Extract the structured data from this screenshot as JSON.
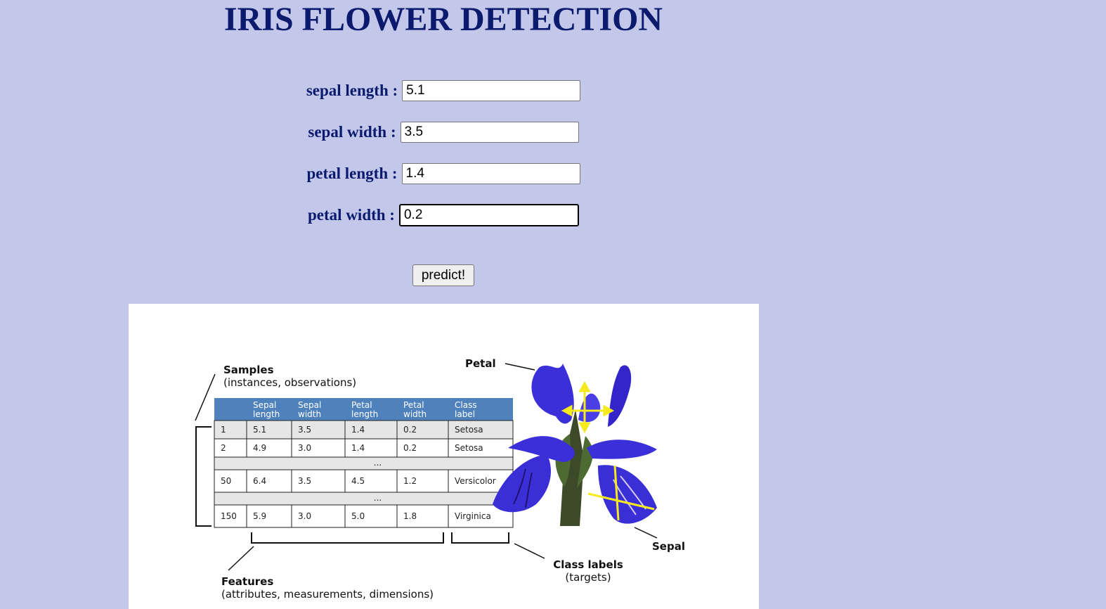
{
  "page": {
    "title": "IRIS FLOWER DETECTION"
  },
  "form": {
    "fields": [
      {
        "label": "sepal length :",
        "value": "5.1"
      },
      {
        "label": "sepal width :",
        "value": "3.5"
      },
      {
        "label": "petal length :",
        "value": "1.4"
      },
      {
        "label": "petal width :",
        "value": "0.2"
      }
    ],
    "submit_label": "predict!"
  },
  "figure": {
    "samples_title": "Samples",
    "samples_subtitle": "(instances, observations)",
    "petal_label": "Petal",
    "sepal_label": "Sepal",
    "class_labels_title": "Class labels",
    "class_labels_subtitle": "(targets)",
    "features_title": "Features",
    "features_subtitle": "(attributes, measurements, dimensions)",
    "table": {
      "headers": [
        [
          "",
          ""
        ],
        [
          "Sepal",
          "length"
        ],
        [
          "Sepal",
          "width"
        ],
        [
          "Petal",
          "length"
        ],
        [
          "Petal",
          "width"
        ],
        [
          "Class",
          "label"
        ]
      ],
      "rows": [
        [
          "1",
          "5.1",
          "3.5",
          "1.4",
          "0.2",
          "Setosa"
        ],
        [
          "2",
          "4.9",
          "3.0",
          "1.4",
          "0.2",
          "Setosa"
        ],
        [
          "...",
          "",
          "",
          "",
          "",
          ""
        ],
        [
          "50",
          "6.4",
          "3.5",
          "4.5",
          "1.2",
          "Versicolor"
        ],
        [
          "...",
          "",
          "",
          "",
          "",
          ""
        ],
        [
          "150",
          "5.9",
          "3.0",
          "5.0",
          "1.8",
          "Virginica"
        ]
      ]
    }
  },
  "colors": {
    "background": "#c3c8eb",
    "title_text": "#0c1a6e",
    "table_header": "#4f81bd",
    "iris_petal": "#3b2fd9",
    "arrow": "#f5ea1c"
  }
}
